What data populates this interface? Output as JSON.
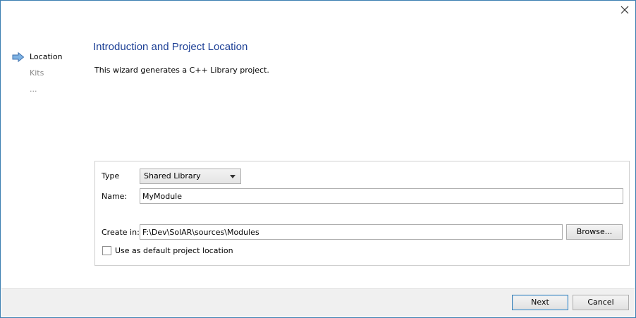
{
  "steps": [
    {
      "label": "Location",
      "active": true
    },
    {
      "label": "Kits",
      "active": false
    },
    {
      "label": "...",
      "active": false
    }
  ],
  "page": {
    "title": "Introduction and Project Location",
    "subtitle": "This wizard generates a C++ Library project."
  },
  "form": {
    "type_label": "Type",
    "type_value": "Shared Library",
    "name_label": "Name:",
    "name_value": "MyModule",
    "create_in_label": "Create in:",
    "create_in_value": "F:\\Dev\\SolAR\\sources\\Modules",
    "browse_label": "Browse...",
    "default_location_label": "Use as default project location",
    "default_location_checked": false
  },
  "footer": {
    "next_label": "Next",
    "cancel_label": "Cancel"
  },
  "icons": {
    "close": "close-icon",
    "current_step": "arrow-right-icon",
    "dropdown": "chevron-down-icon"
  },
  "colors": {
    "title": "#1c3f95",
    "accent": "#3c7fb1",
    "inactive_step": "#8a8a8a"
  }
}
